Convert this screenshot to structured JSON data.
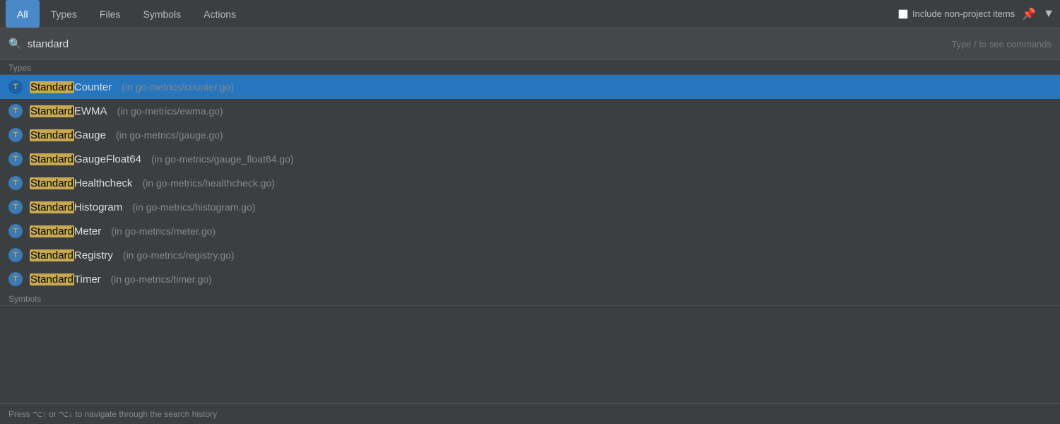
{
  "tabs": [
    {
      "id": "all",
      "label": "All",
      "active": true
    },
    {
      "id": "types",
      "label": "Types",
      "active": false
    },
    {
      "id": "files",
      "label": "Files",
      "active": false
    },
    {
      "id": "symbols",
      "label": "Symbols",
      "active": false
    },
    {
      "id": "actions",
      "label": "Actions",
      "active": false
    }
  ],
  "right_controls": {
    "checkbox_label": "Include non-project items",
    "pin_icon": "📌",
    "filter_icon": "▼"
  },
  "search": {
    "value": "standard",
    "placeholder": "",
    "hint": "Type / to see commands"
  },
  "sections": {
    "types_label": "Types",
    "symbols_label": "Symbols"
  },
  "results": [
    {
      "id": 1,
      "badge": "T",
      "name_prefix": "Standard",
      "name_suffix": "Counter",
      "location": "(in go-metrics/counter.go)",
      "selected": true
    },
    {
      "id": 2,
      "badge": "T",
      "name_prefix": "Standard",
      "name_suffix": "EWMA",
      "location": "(in go-metrics/ewma.go)",
      "selected": false
    },
    {
      "id": 3,
      "badge": "T",
      "name_prefix": "Standard",
      "name_suffix": "Gauge",
      "location": "(in go-metrics/gauge.go)",
      "selected": false
    },
    {
      "id": 4,
      "badge": "T",
      "name_prefix": "Standard",
      "name_suffix": "GaugeFloat64",
      "location": "(in go-metrics/gauge_float64.go)",
      "selected": false
    },
    {
      "id": 5,
      "badge": "T",
      "name_prefix": "Standard",
      "name_suffix": "Healthcheck",
      "location": "(in go-metrics/healthcheck.go)",
      "selected": false
    },
    {
      "id": 6,
      "badge": "T",
      "name_prefix": "Standard",
      "name_suffix": "Histogram",
      "location": "(in go-metrics/histogram.go)",
      "selected": false
    },
    {
      "id": 7,
      "badge": "T",
      "name_prefix": "Standard",
      "name_suffix": "Meter",
      "location": "(in go-metrics/meter.go)",
      "selected": false
    },
    {
      "id": 8,
      "badge": "T",
      "name_prefix": "Standard",
      "name_suffix": "Registry",
      "location": "(in go-metrics/registry.go)",
      "selected": false
    },
    {
      "id": 9,
      "badge": "T",
      "name_prefix": "Standard",
      "name_suffix": "Timer",
      "location": "(in go-metrics/timer.go)",
      "selected": false
    }
  ],
  "bottom_hint": "Press ⌥↑ or ⌥↓ to navigate through the search history"
}
